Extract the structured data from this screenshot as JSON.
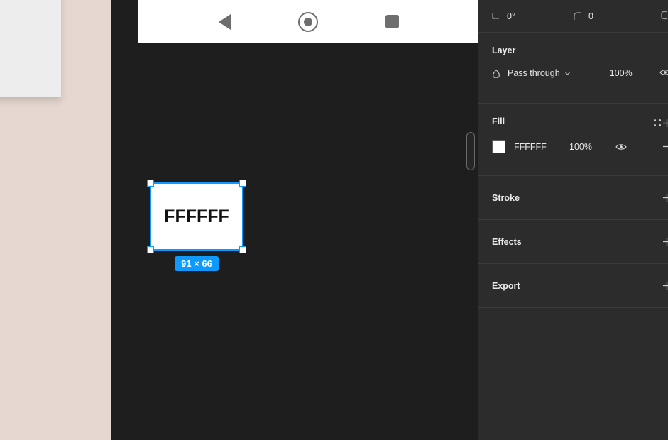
{
  "canvas": {
    "navbar": {
      "back_icon": "triangle-back-icon",
      "home_icon": "circle-home-icon",
      "recents_icon": "square-recents-icon"
    },
    "selection": {
      "shape_label": "FFFFFF",
      "size_badge": "91 × 66",
      "accent_color": "#0D99FF",
      "fill_color": "#FFFFFF"
    },
    "background_color": "#1E1E1E",
    "scroll_handle": "vertical-resize-handle"
  },
  "backdrop": {
    "color": "#E6D8D0",
    "panel_color": "#EEEDED"
  },
  "properties_panel": {
    "background_color": "#2C2C2C",
    "transform": {
      "rotation_icon": "rotation-angle-icon",
      "rotation_value": "0°",
      "corner_radius_icon": "corner-radius-icon",
      "corner_radius_value": "0",
      "independent_corners_icon": "independent-corners-icon"
    },
    "layer": {
      "title": "Layer",
      "blend_icon": "blend-mode-icon",
      "blend_mode": "Pass through",
      "chevron_icon": "chevron-down-icon",
      "opacity": "100%",
      "visibility_icon": "eye-icon"
    },
    "fill": {
      "title": "Fill",
      "styles_icon": "four-dots-icon",
      "add_icon": "plus-icon",
      "swatch_color": "#FFFFFF",
      "hex": "FFFFFF",
      "opacity": "100%",
      "visibility_icon": "eye-icon"
    },
    "stroke": {
      "title": "Stroke",
      "add_icon": "plus-icon"
    },
    "effects": {
      "title": "Effects",
      "add_icon": "plus-icon"
    },
    "export": {
      "title": "Export",
      "add_icon": "plus-icon"
    }
  }
}
